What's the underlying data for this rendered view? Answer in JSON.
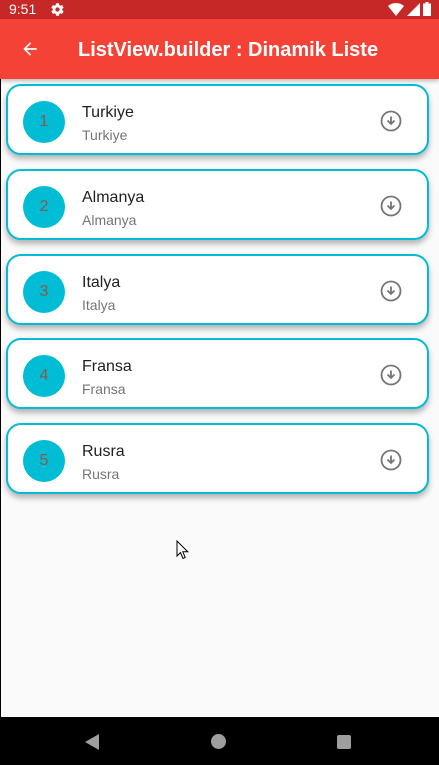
{
  "status_bar": {
    "time": "9:51",
    "icons": [
      "gear-icon",
      "wifi-icon",
      "signal-icon",
      "battery-icon"
    ]
  },
  "app_bar": {
    "title": "ListView.builder : Dinamik Liste",
    "back_icon": "arrow-back-icon"
  },
  "list": {
    "items": [
      {
        "number": "1",
        "title": "Turkiye",
        "subtitle": "Turkiye",
        "icon": "download-circle-icon"
      },
      {
        "number": "2",
        "title": "Almanya",
        "subtitle": "Almanya",
        "icon": "download-circle-icon"
      },
      {
        "number": "3",
        "title": "Italya",
        "subtitle": "Italya",
        "icon": "download-circle-icon"
      },
      {
        "number": "4",
        "title": "Fransa",
        "subtitle": "Fransa",
        "icon": "download-circle-icon"
      },
      {
        "number": "5",
        "title": "Rusra",
        "subtitle": "Rusra",
        "icon": "download-circle-icon"
      }
    ]
  },
  "colors": {
    "status_bar": "#c62828",
    "app_bar": "#f44336",
    "card_border": "#00bcd4",
    "avatar_bg": "#00bcd4",
    "avatar_text": "#8d5a44",
    "background": "#fafafa"
  },
  "nav_bar": {
    "icons": [
      "nav-back-icon",
      "nav-home-icon",
      "nav-recent-icon"
    ]
  }
}
